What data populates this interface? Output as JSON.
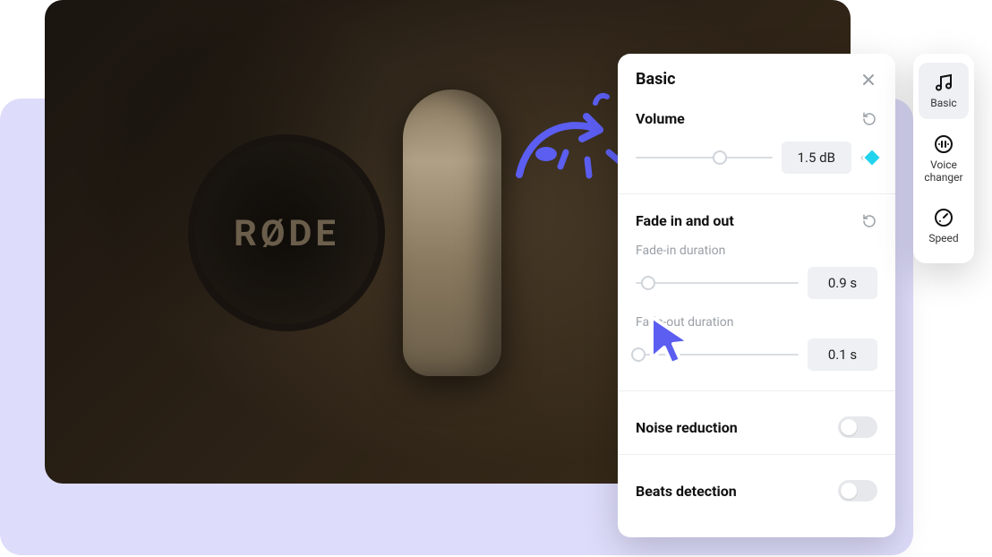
{
  "panel": {
    "title": "Basic",
    "sections": {
      "volume": {
        "title": "Volume",
        "value": "1.5 dB",
        "slider_pct": 62
      },
      "fade": {
        "title": "Fade in and out",
        "in_label": "Fade-in duration",
        "in_value": "0.9 s",
        "in_pct": 8,
        "out_label": "Fade-out duration",
        "out_value": "0.1 s",
        "out_pct": 2
      },
      "noise": {
        "label": "Noise reduction",
        "on": false
      },
      "beats": {
        "label": "Beats detection",
        "on": false
      }
    }
  },
  "sidebar": {
    "items": [
      {
        "label": "Basic",
        "active": true
      },
      {
        "label": "Voice changer",
        "active": false
      },
      {
        "label": "Speed",
        "active": false
      }
    ]
  },
  "hero": {
    "brand": "RØDE"
  }
}
